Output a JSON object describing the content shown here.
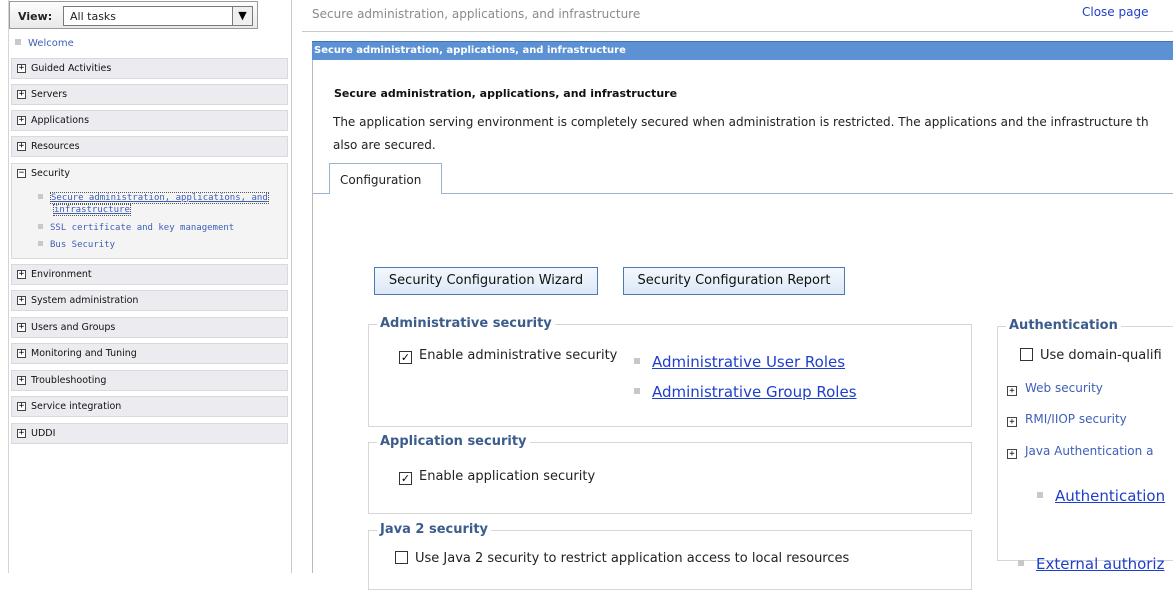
{
  "nav": {
    "view_label": "View:",
    "view_value": "All tasks",
    "welcome": "Welcome",
    "items_top": [
      {
        "label": "Guided Activities",
        "toggle": "+"
      },
      {
        "label": "Servers",
        "toggle": "+"
      },
      {
        "label": "Applications",
        "toggle": "+"
      },
      {
        "label": "Resources",
        "toggle": "+"
      }
    ],
    "security": {
      "label": "Security",
      "toggle": "−",
      "links": [
        "Secure administration, applications, and",
        "infrastructure",
        "SSL certificate and key management",
        "Bus Security"
      ]
    },
    "items_bottom": [
      {
        "label": "Environment",
        "toggle": "+"
      },
      {
        "label": "System administration",
        "toggle": "+"
      },
      {
        "label": "Users and Groups",
        "toggle": "+"
      },
      {
        "label": "Monitoring and Tuning",
        "toggle": "+"
      },
      {
        "label": "Troubleshooting",
        "toggle": "+"
      },
      {
        "label": "Service integration",
        "toggle": "+"
      },
      {
        "label": "UDDI",
        "toggle": "+"
      }
    ]
  },
  "main": {
    "page_title": "Secure administration, applications, and infrastructure",
    "close_page": "Close page",
    "band_title": "Secure administration, applications, and infrastructure",
    "heading": "Secure administration, applications, and infrastructure",
    "desc_line1": "The application serving environment is completely secured when administration is restricted. The applications and the infrastructure th",
    "desc_line2": "also are secured.",
    "tab": "Configuration",
    "wizard_button": "Security Configuration Wizard",
    "report_button": "Security Configuration Report",
    "admin_security": {
      "legend": "Administrative security",
      "checkbox_label": "Enable administrative security",
      "checked_mark": "✓",
      "links": [
        "Administrative User Roles",
        "Administrative Group Roles"
      ]
    },
    "app_security": {
      "legend": "Application security",
      "checkbox_label": "Enable application security",
      "checked_mark": "✓"
    },
    "java2_security": {
      "legend": "Java 2 security",
      "checkbox_label": "Use Java 2 security to restrict application access to local resources"
    },
    "authentication": {
      "legend": "Authentication",
      "checkbox_label": "Use domain-qualifi",
      "expanders": [
        "Web security",
        "RMI/IIOP security",
        "Java Authentication a"
      ],
      "link": "Authentication",
      "external": "External authoriz"
    }
  }
}
